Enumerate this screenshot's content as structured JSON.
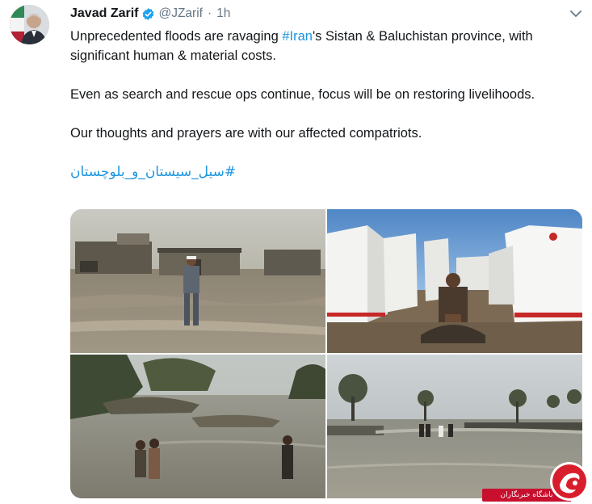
{
  "tweet": {
    "author_name": "Javad Zarif",
    "handle": "@JZarif",
    "separator": "·",
    "time": "1h",
    "paragraphs": [
      {
        "before": "Unprecedented floods are ravaging ",
        "hashtag": "#Iran",
        "after": "'s Sistan & Baluchistan province, with significant human & material costs."
      },
      {
        "text": "Even as search and rescue ops continue, focus will be on restoring livelihoods."
      },
      {
        "text": "Our thoughts and prayers are with our affected compatriots."
      }
    ],
    "persian_hashtag": "#سیل_سیستان_و_بلوچستان"
  },
  "media": {
    "photos": [
      {
        "subject": "man-walking-through-flooded-village"
      },
      {
        "subject": "man-sitting-before-red-crescent-tents"
      },
      {
        "subject": "people-wading-in-floodwater"
      },
      {
        "subject": "flooded-road-with-people-crossing"
      }
    ]
  },
  "watermark": {
    "caption": "باشگاه خبرنگاران"
  },
  "colors": {
    "link": "#1b95e0",
    "secondary_text": "#657786",
    "verified": "#1da1f2",
    "watermark_red": "#c8102e"
  },
  "icons": [
    "verified-badge-icon",
    "chevron-down-icon",
    "watermark-logo-icon"
  ]
}
